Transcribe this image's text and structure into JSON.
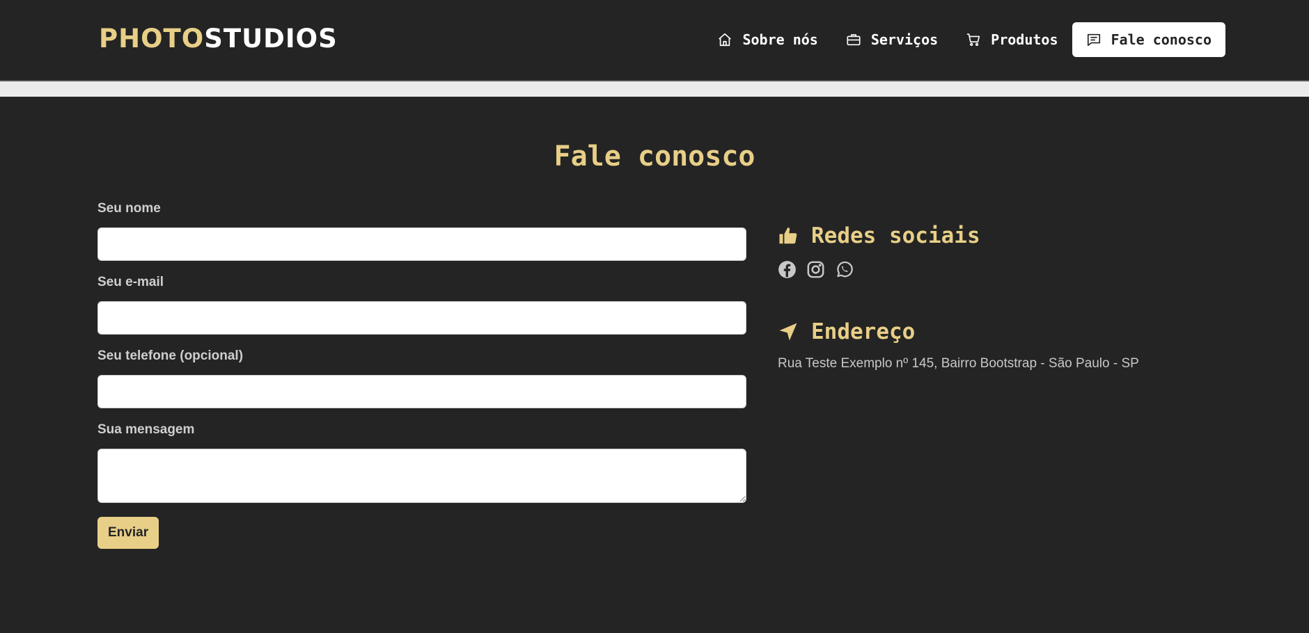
{
  "brand": {
    "part1": "PHOTO",
    "part2": "STUDIOS"
  },
  "nav": {
    "items": [
      {
        "label": "Sobre nós",
        "icon": "house-icon"
      },
      {
        "label": "Serviços",
        "icon": "briefcase-icon"
      },
      {
        "label": "Produtos",
        "icon": "cart-icon"
      },
      {
        "label": "Fale conosco",
        "icon": "chat-icon",
        "active": true
      }
    ]
  },
  "contact": {
    "title": "Fale conosco",
    "form": {
      "name_label": "Seu nome",
      "name_value": "",
      "email_label": "Seu e-mail",
      "email_value": "",
      "phone_label": "Seu telefone (opcional)",
      "phone_value": "",
      "message_label": "Sua mensagem",
      "message_value": "",
      "submit_label": "Enviar"
    },
    "social": {
      "title": "Redes sociais",
      "icons": [
        "facebook-icon",
        "instagram-icon",
        "whatsapp-icon"
      ]
    },
    "address": {
      "title": "Endereço",
      "text": "Rua Teste Exemplo nº 145, Bairro Bootstrap - São Paulo - SP"
    }
  },
  "colors": {
    "background": "#242424",
    "accent": "#e8cf87",
    "text": "#cccccc",
    "white": "#ffffff",
    "divider": "#ebebeb"
  }
}
